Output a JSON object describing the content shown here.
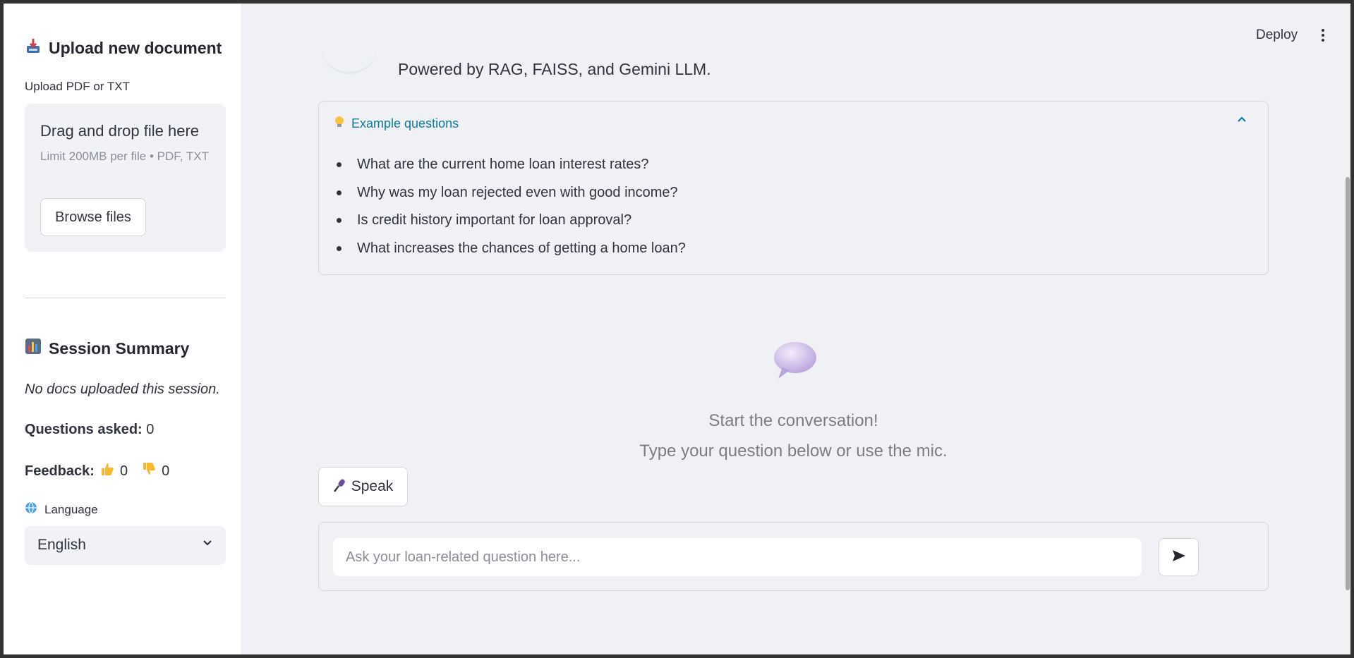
{
  "sidebar": {
    "upload": {
      "icon": "inbox-tray-icon",
      "title": "Upload new document",
      "label": "Upload PDF or TXT",
      "drop_text": "Drag and drop file here",
      "limit_text": "Limit 200MB per file • PDF, TXT",
      "browse_label": "Browse files"
    },
    "summary": {
      "icon": "bar-chart-icon",
      "title": "Session Summary",
      "no_docs": "No docs uploaded this session.",
      "questions_label": "Questions asked:",
      "questions_value": "0",
      "feedback_label": "Feedback:",
      "thumbs_up_count": "0",
      "thumbs_down_count": "0"
    },
    "language": {
      "label": "Language",
      "selected": "English"
    }
  },
  "header": {
    "deploy_label": "Deploy"
  },
  "main": {
    "subtitle": "Powered by RAG, FAISS, and Gemini LLM.",
    "examples": {
      "title": "Example questions",
      "items": [
        "What are the current home loan interest rates?",
        "Why was my loan rejected even with good income?",
        "Is credit history important for loan approval?",
        "What increases the chances of getting a home loan?"
      ]
    },
    "empty_state": {
      "title": "Start the conversation!",
      "subtitle": "Type your question below or use the mic."
    },
    "speak_label": "Speak",
    "chat": {
      "placeholder": "Ask your loan-related question here..."
    }
  },
  "colors": {
    "accent_link": "#0f7aa3",
    "sidebar_bg": "#ffffff",
    "main_bg": "#f0f1f5"
  }
}
